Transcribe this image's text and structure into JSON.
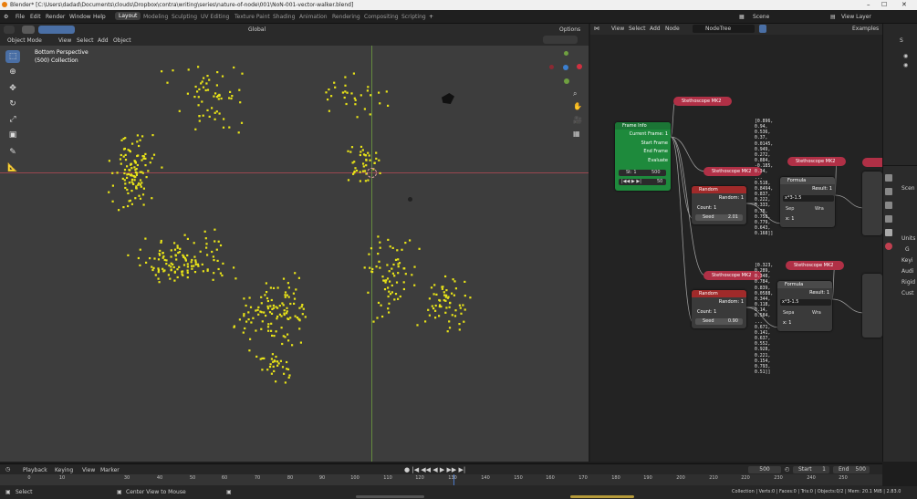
{
  "title": "Blender* [C:\\Users\\dadad\\Documents\\clouds\\Dropbox\\contra\\writing\\series\\nature-of-node\\001\\NoN-001-vector-walker.blend]",
  "menu": [
    "File",
    "Edit",
    "Render",
    "Window",
    "Help"
  ],
  "workspaces": [
    "Layout",
    "Modeling",
    "Sculpting",
    "UV Editing",
    "Texture Paint",
    "Shading",
    "Animation",
    "Rendering",
    "Compositing",
    "Scripting"
  ],
  "workspace_add": "+",
  "scene": "Scene",
  "view_layer": "View Layer",
  "viewport": {
    "mode": "Object Mode",
    "menu": [
      "View",
      "Select",
      "Add",
      "Object"
    ],
    "orientation": "Global",
    "options": "Options",
    "overlay_title": "Bottom Perspective",
    "overlay_collection": "(500) Collection"
  },
  "node_editor": {
    "menu": [
      "View",
      "Select",
      "Add",
      "Node"
    ],
    "tree_name": "NodeTree",
    "examples": "Examples",
    "frame_info": {
      "title": "Frame Info",
      "outputs": [
        "Current Frame: 1",
        "Start Frame",
        "End Frame",
        "Evaluate"
      ],
      "st": "St: 1",
      "en": "500",
      "frame_value": "50"
    },
    "scope_label": "Stethoscope MK2",
    "random_label": "Random",
    "random_output": "Random: 1",
    "count_label": "Count: 1",
    "seed_1_label": "Seed",
    "seed_1_value": "2.01",
    "seed_2_label": "Seed",
    "seed_2_value": "0.90",
    "formula_label": "Formula",
    "formula_result": "Result: 1",
    "formula_expr": "x*3-1.5",
    "sep_1": "Sep",
    "wra_1": "Wra",
    "sep_2": "Sepa",
    "wra_2": "Wra",
    "x_1": "x: 1",
    "readout_1": "[0.896,\n0.94,\n0.536,\n0.37,\n0.0145,\n0.949,\n0.272,\n0.884,\n-0.185,\n0.34,\n...\n0.518,\n0.8494,\n0.837,\n0.222,\n0.333,\n0.78,\n0.758,\n0.779,\n0.643,\n0.168]]",
    "readout_2": "[0.323,\n0.289,\n0.348,\n0.784,\n0.839,\n0.0588,\n0.344,\n0.118,\n0.14,\n0.584,\n...\n0.671,\n0.141,\n0.637,\n0.552,\n0.928,\n0.221,\n0.154,\n0.793,\n0.51]]"
  },
  "properties": {
    "outliner_items": [
      "S",
      "Scen",
      "Units",
      "G",
      "Keyi",
      "Audi",
      "Rigid",
      "Cust"
    ]
  },
  "timeline": {
    "menu": [
      "Playback",
      "Keying",
      "View",
      "Marker"
    ],
    "current": "500",
    "start_label": "Start",
    "start": "1",
    "end_label": "End",
    "end": "500",
    "ticks": [
      "0",
      "10",
      "30",
      "40",
      "50",
      "60",
      "70",
      "80",
      "90",
      "100",
      "110",
      "120",
      "130",
      "140",
      "150",
      "160",
      "170",
      "180",
      "190",
      "200",
      "210",
      "220",
      "230",
      "240",
      "250"
    ]
  },
  "status": {
    "select": "Select",
    "center": "Center View to Mouse",
    "stats": "Collection | Verts:0 | Faces:0 | Tris:0 | Objects:0/2 | Mem: 20.1 MiB | 2.83.0"
  },
  "colors": {
    "point": "#e8e318",
    "scope": "#b03046",
    "frame_node": "#1e8a3c",
    "random_header": "#a02a2a",
    "formula_header": "#3b3b3b"
  },
  "icons": {
    "window_controls": [
      "minimize-icon",
      "maximize-icon",
      "close-icon"
    ],
    "tools": [
      "select-box-icon",
      "cursor-icon",
      "move-icon",
      "rotate-icon",
      "scale-icon",
      "transform-icon",
      "annotate-icon",
      "measure-icon"
    ]
  }
}
